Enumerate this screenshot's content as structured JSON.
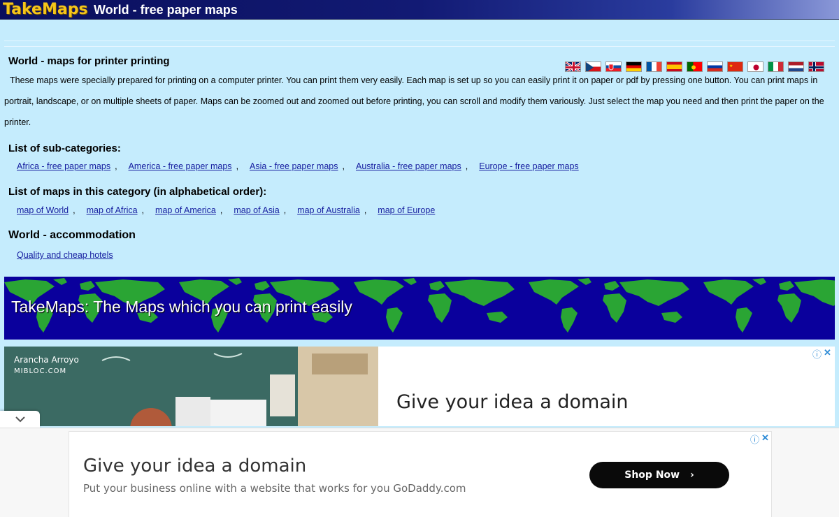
{
  "header": {
    "logo_text": "TakeMaps",
    "title": "World - free paper maps"
  },
  "intro": {
    "title": "World - maps for printer printing",
    "text": "These maps were specially prepared for printing on a computer printer. You can print them very easily. Each map is set up so you can easily print it on paper or pdf by pressing one button. You can print maps in portrait, landscape, or on multiple sheets of paper. Maps can be zoomed out and zoomed out before printing, you can scroll and modify them variously. Just select the map you need and then print the paper on the printer."
  },
  "language_flags": [
    "uk-flag-icon",
    "czech-flag-icon",
    "slovak-flag-icon",
    "german-flag-icon",
    "french-flag-icon",
    "spanish-flag-icon",
    "portuguese-flag-icon",
    "russian-flag-icon",
    "chinese-flag-icon",
    "japanese-flag-icon",
    "italian-flag-icon",
    "dutch-flag-icon",
    "norwegian-flag-icon"
  ],
  "subcategories": {
    "title": "List of sub-categories:",
    "links": [
      "Africa - free paper maps",
      "America - free paper maps",
      "Asia - free paper maps",
      "Australia - free paper maps",
      "Europe - free paper maps"
    ]
  },
  "maps": {
    "title": "List of maps in this category (in alphabetical order):",
    "links": [
      "map of World",
      "map of Africa",
      "map of America",
      "map of Asia",
      "map of Australia",
      "map of Europe"
    ]
  },
  "accommodation": {
    "title": "World - accommodation",
    "link": "Quality and cheap hotels"
  },
  "banner": {
    "text": "TakeMaps: The Maps which you can print easily",
    "colors": {
      "background": "#0a009c",
      "land": "#2aa534"
    }
  },
  "ad_top": {
    "photo_credit_name": "Arancha Arroyo",
    "photo_credit_site": "MIBLOC.COM",
    "headline": "Give your idea a domain"
  },
  "ad_bottom": {
    "headline": "Give your idea a domain",
    "subtext": "Put your business online with a website that works for you GoDaddy.com",
    "button_label": "Shop Now"
  },
  "colors": {
    "page_background": "#c5ecfd",
    "header_bar": "#0a0f5c",
    "logo": "#f4c51a",
    "link": "#161ea0"
  }
}
